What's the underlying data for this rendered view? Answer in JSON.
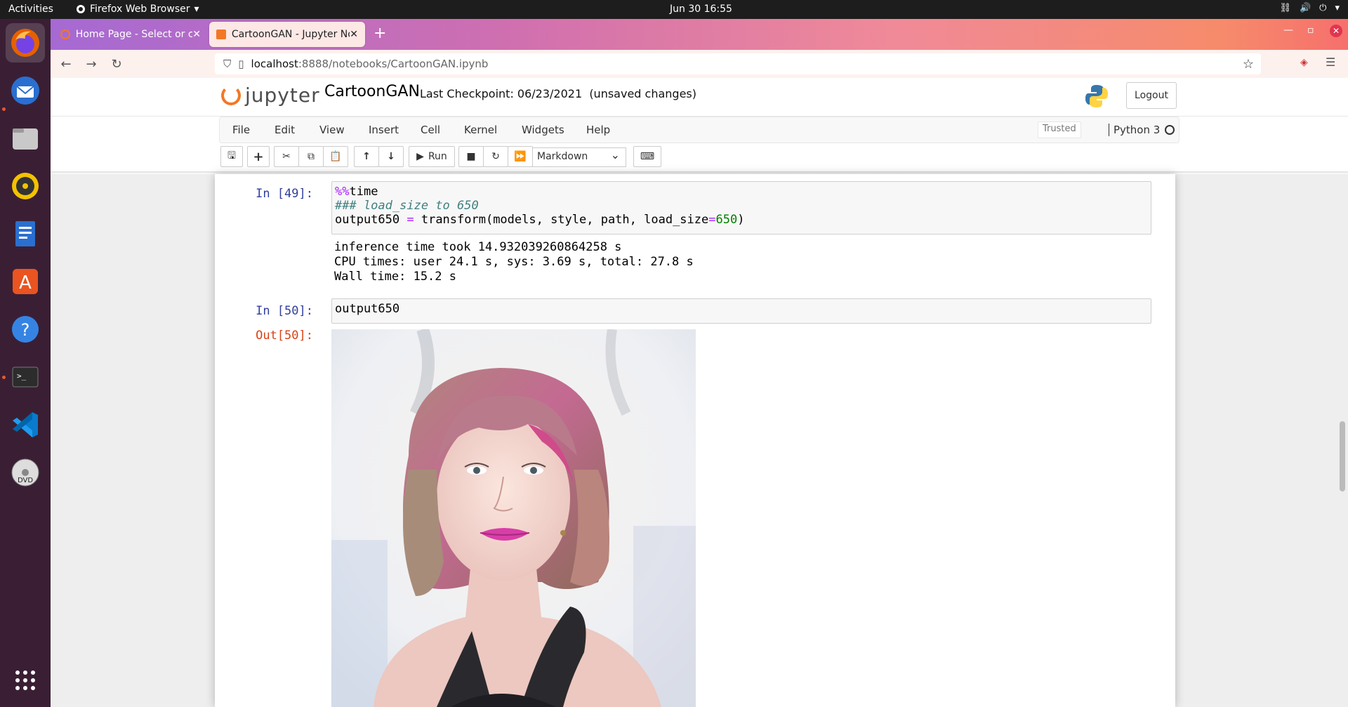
{
  "topbar": {
    "activities": "Activities",
    "app_name": "Firefox Web Browser",
    "clock": "Jun 30  16:55"
  },
  "dock": {
    "items": [
      "firefox-icon",
      "thunderbird-icon",
      "files-icon",
      "rhythmbox-icon",
      "writer-icon",
      "software-icon",
      "help-icon",
      "terminal-icon",
      "vscode-icon",
      "dvd-icon",
      "apps-grid-icon"
    ]
  },
  "browser": {
    "tabs": [
      {
        "label": "Home Page - Select or cre",
        "active": false
      },
      {
        "label": "CartoonGAN - Jupyter No",
        "active": true
      }
    ],
    "url_host": "localhost",
    "url_path": ":8888/notebooks/CartoonGAN.ipynb"
  },
  "jupyter": {
    "logo_text": "jupyter",
    "notebook_name": "CartoonGAN",
    "checkpoint": "Last Checkpoint: 06/23/2021",
    "unsaved": "(unsaved changes)",
    "logout": "Logout",
    "menu": [
      "File",
      "Edit",
      "View",
      "Insert",
      "Cell",
      "Kernel",
      "Widgets",
      "Help"
    ],
    "trusted": "Trusted",
    "kernel": "Python 3",
    "toolbar": {
      "run_label": "Run",
      "cell_type": "Markdown"
    }
  },
  "cells": {
    "c1_prompt": "In [49]:",
    "c1_line1_magic": "%%",
    "c1_line1_rest": "time",
    "c1_line2": "### load_size to 650",
    "c1_line3_a": "output650 ",
    "c1_line3_eq": "=",
    "c1_line3_b": " transform(models, style, path, load_size",
    "c1_line3_eq2": "=",
    "c1_line3_num": "650",
    "c1_line3_end": ")",
    "c1_output": "inference time took 14.932039260864258 s\nCPU times: user 24.1 s, sys: 3.69 s, total: 27.8 s\nWall time: 15.2 s",
    "c2_prompt": "In [50]:",
    "c2_code": "output650",
    "c2_out_prompt": "Out[50]:"
  }
}
